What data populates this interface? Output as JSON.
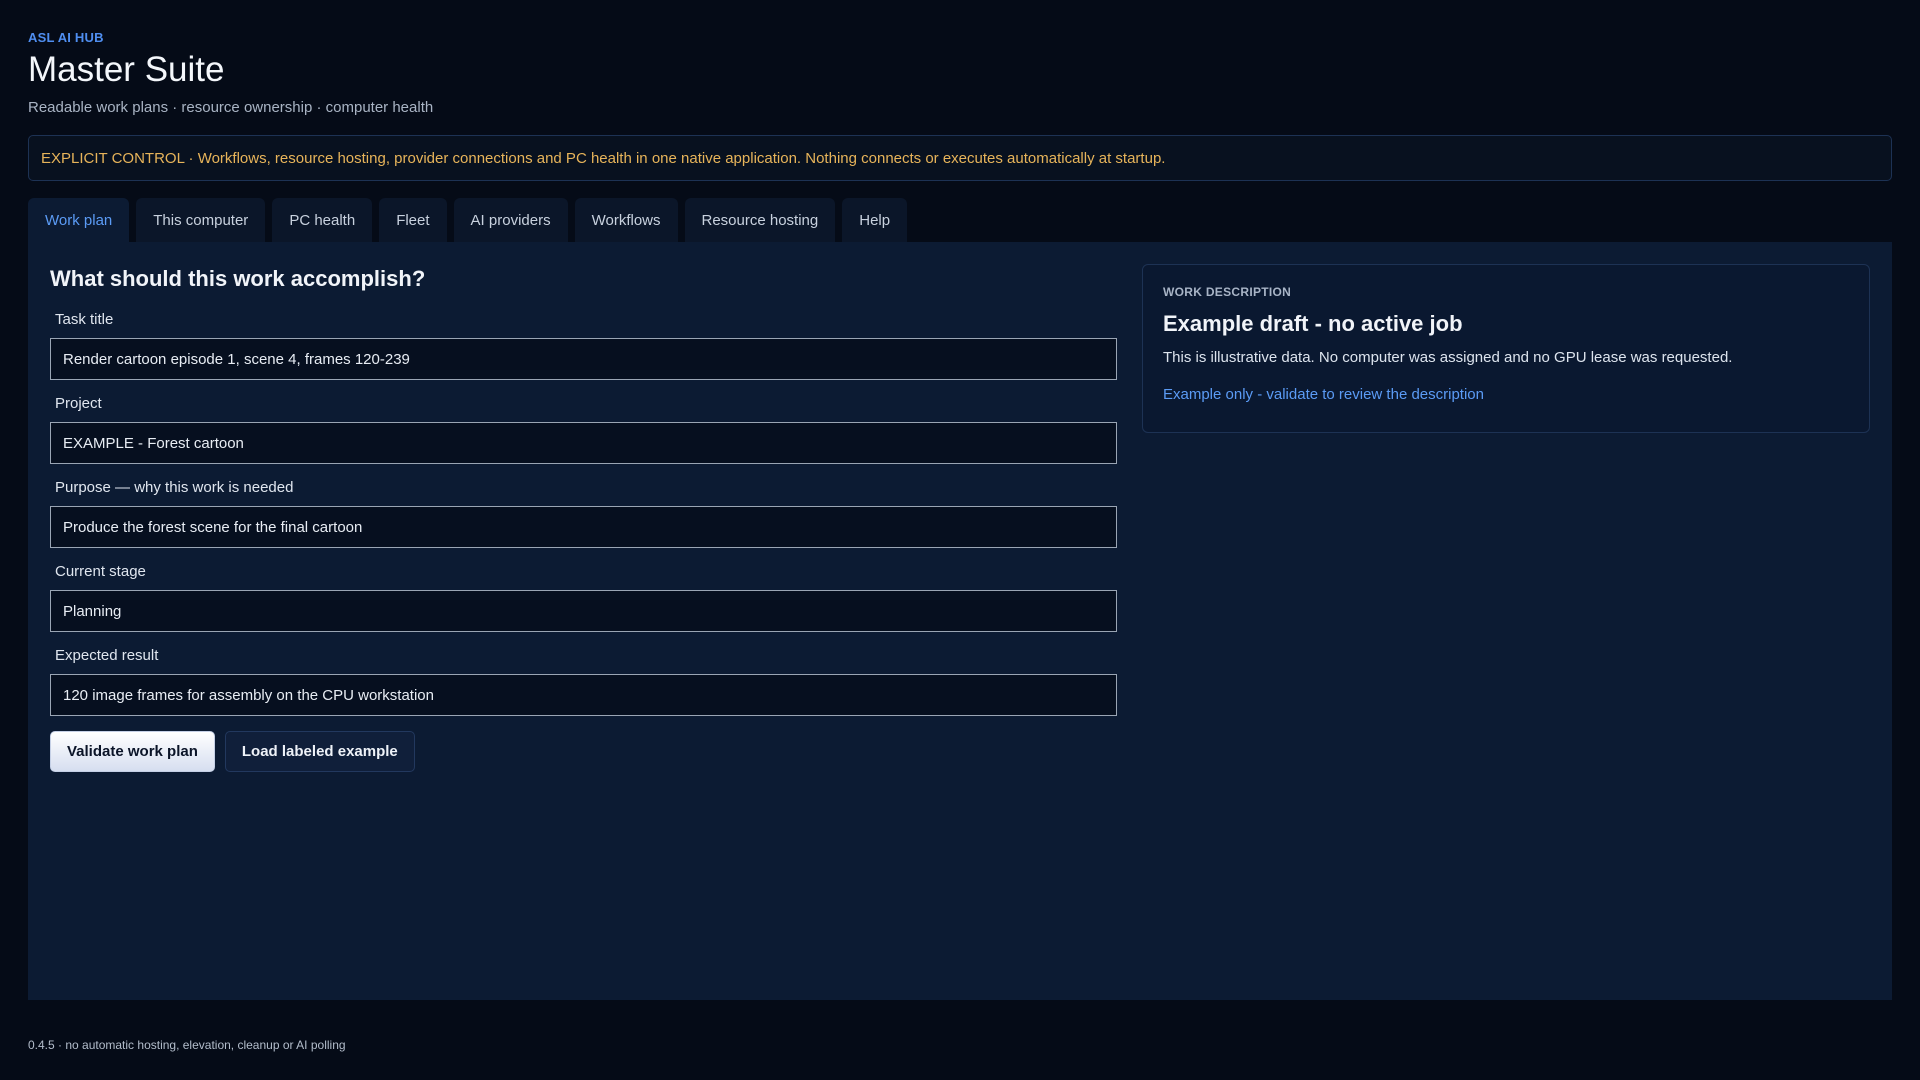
{
  "app": {
    "brand": "ASL AI HUB",
    "title": "Master Suite",
    "subtitle": "Readable work plans · resource ownership · computer health",
    "notice": "EXPLICIT CONTROL · Workflows, resource hosting, provider connections and PC health in one native application. Nothing connects or executes automatically at startup."
  },
  "tabs": [
    {
      "label": "Work plan",
      "active": true
    },
    {
      "label": "This computer"
    },
    {
      "label": "PC health"
    },
    {
      "label": "Fleet"
    },
    {
      "label": "AI providers"
    },
    {
      "label": "Workflows"
    },
    {
      "label": "Resource hosting"
    },
    {
      "label": "Help"
    }
  ],
  "form": {
    "heading": "What should this work accomplish?",
    "fields": [
      {
        "label": "Task title",
        "value": "Render cartoon episode 1, scene 4, frames 120-239"
      },
      {
        "label": "Project",
        "value": "EXAMPLE - Forest cartoon"
      },
      {
        "label": "Purpose — why this work is needed",
        "value": "Produce the forest scene for the final cartoon"
      },
      {
        "label": "Current stage",
        "value": "Planning"
      },
      {
        "label": "Expected result",
        "value": "120 image frames for assembly on the CPU workstation"
      }
    ],
    "validate_label": "Validate work plan",
    "example_label": "Load labeled example"
  },
  "description": {
    "label": "WORK DESCRIPTION",
    "heading": "Example draft - no active job",
    "body": "This is illustrative data. No computer was assigned and no GPU lease was requested.",
    "link": "Example only - validate to review the description"
  },
  "footer": "0.4.5 · no automatic hosting, elevation, cleanup or AI polling",
  "colors": {
    "background": "#050b17",
    "panel": "#0c1b33",
    "accent": "#5b9bf5",
    "notice": "#e7b45a"
  }
}
